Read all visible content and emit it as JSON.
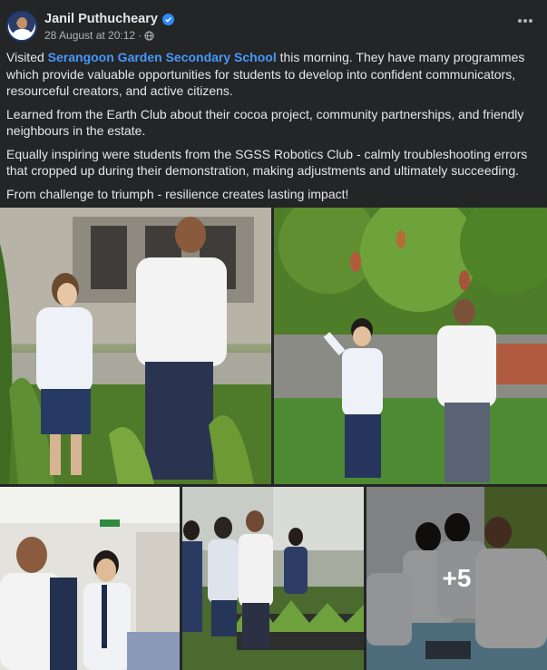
{
  "post": {
    "author": "Janil Puthucheary",
    "timestamp": "28 August at 20:12",
    "separator": "·",
    "paragraphs": {
      "p1_before": "Visited ",
      "p1_link": "Serangoon Garden Secondary School",
      "p1_after": " this morning. They have many programmes which provide valuable opportunities for students to develop into confident communicators, resourceful creators, and active citizens.",
      "p2": "Learned from the Earth Club about their cocoa project, community partnerships, and friendly neighbours in the estate.",
      "p3": "Equally inspiring were students from the SGSS Robotics Club - calmly troubleshooting errors that cropped up during their demonstration, making adjustments and ultimately succeeding.",
      "p4": "From challenge to triumph - resilience creates lasting impact!"
    },
    "more_photos_label": "+5"
  },
  "icons": {
    "verified": "verified-badge-icon",
    "audience": "globe-icon",
    "options": "more-options-icon"
  },
  "colors": {
    "background": "#242526",
    "link": "#4599ff",
    "verified": "#2d88ff",
    "secondary_text": "#b0b3b8"
  }
}
